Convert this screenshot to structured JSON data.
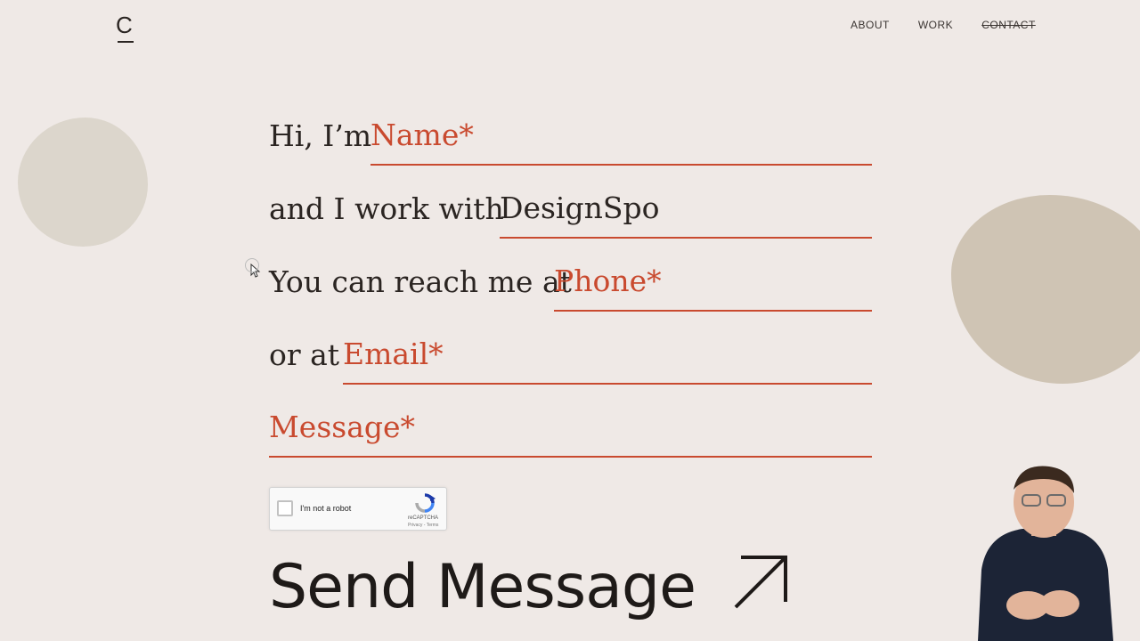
{
  "nav": {
    "logo": "C",
    "items": [
      {
        "label": "ABOUT",
        "active": false
      },
      {
        "label": "WORK",
        "active": false
      },
      {
        "label": "CONTACT",
        "active": true
      }
    ]
  },
  "form": {
    "name": {
      "lead": "Hi, I’m",
      "placeholder": "Name*"
    },
    "company": {
      "lead": "and I work with",
      "value": "DesignSpo"
    },
    "phone": {
      "lead": "You can reach me at",
      "placeholder": "Phone*"
    },
    "email": {
      "lead": "or at",
      "placeholder": "Email*"
    },
    "message": {
      "placeholder": "Message*"
    }
  },
  "recaptcha": {
    "label": "I'm not a robot",
    "brand": "reCAPTCHA",
    "terms": "Privacy - Terms"
  },
  "send": {
    "label": "Send Message"
  },
  "icons": [
    "arrow-up-right-icon",
    "recaptcha-icon",
    "cursor-icon"
  ],
  "colors": {
    "accent": "#c94a2f",
    "background": "#efe9e6",
    "text": "#2b2522",
    "blob_light": "#dcd6cc",
    "blob_dark": "#cfc4b4"
  }
}
